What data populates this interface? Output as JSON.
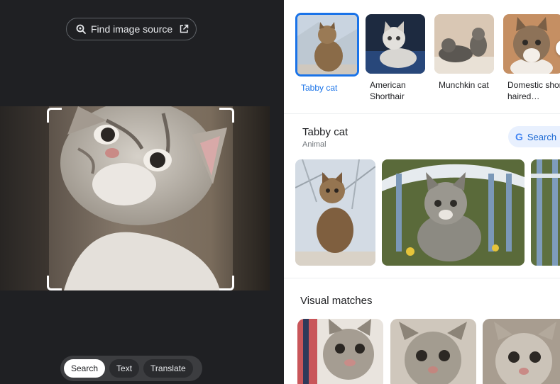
{
  "left_panel": {
    "find_source_label": "Find image source",
    "modes": [
      {
        "label": "Search",
        "active": true
      },
      {
        "label": "Text",
        "active": false
      },
      {
        "label": "Translate",
        "active": false
      }
    ]
  },
  "right_panel": {
    "thumbnails": [
      {
        "label": "Tabby cat",
        "selected": true
      },
      {
        "label": "American Shorthair",
        "selected": false
      },
      {
        "label": "Munchkin cat",
        "selected": false
      },
      {
        "label": "Domestic short-haired…",
        "selected": false
      }
    ],
    "entity": {
      "title": "Tabby cat",
      "subtitle": "Animal",
      "search_label": "Search",
      "search_logo": "G"
    },
    "visual_matches_title": "Visual matches"
  },
  "colors": {
    "left_background": "#1f2023",
    "accent_blue": "#1a73e8",
    "search_button_bg": "#e8f0fe"
  },
  "icons": {
    "find_source": "lens-search-icon",
    "open_external": "open-in-new-icon"
  }
}
